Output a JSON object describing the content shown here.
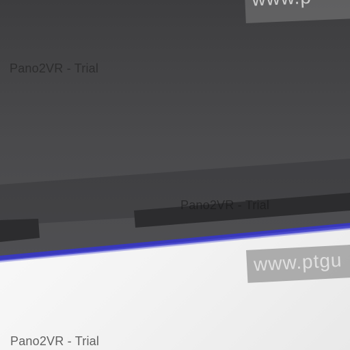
{
  "watermarks": {
    "trial_top": "Pano2VR - Trial",
    "trial_middle": "Pano2VR - Trial",
    "trial_bottom": "Pano2VR - Trial",
    "url_top": "www.p",
    "url_bottom": "www.ptgu"
  },
  "colors": {
    "surface": "#4a4a4c",
    "edge_highlight": "#3b3bd0",
    "floor": "#f4f4f4",
    "slot": "#2c2c2e"
  }
}
